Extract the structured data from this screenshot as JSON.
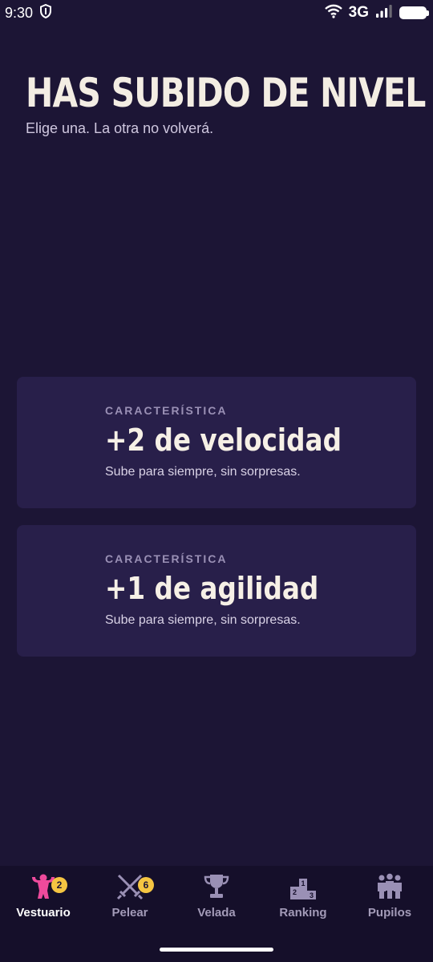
{
  "status_bar": {
    "time": "9:30",
    "network": "3G",
    "icons": [
      "shield-icon",
      "wifi-icon",
      "signal-icon",
      "battery-icon"
    ]
  },
  "header": {
    "title": "HAS SUBIDO DE NIVEL",
    "subtitle": "Elige una. La otra no volverá."
  },
  "options": [
    {
      "category": "CARACTERÍSTICA",
      "title": "+2 de velocidad",
      "description": "Sube para siempre, sin sorpresas."
    },
    {
      "category": "CARACTERÍSTICA",
      "title": "+1 de agilidad",
      "description": "Sube para siempre, sin sorpresas."
    }
  ],
  "nav": {
    "items": [
      {
        "label": "Vestuario",
        "icon": "strongman-icon",
        "badge": "2",
        "active": true
      },
      {
        "label": "Pelear",
        "icon": "crossed-swords-icon",
        "badge": "6",
        "active": false
      },
      {
        "label": "Velada",
        "icon": "trophy-icon",
        "badge": "",
        "active": false
      },
      {
        "label": "Ranking",
        "icon": "podium-icon",
        "badge": "",
        "active": false
      },
      {
        "label": "Pupilos",
        "icon": "group-icon",
        "badge": "",
        "active": false
      }
    ]
  },
  "colors": {
    "background": "#1c1535",
    "card": "#281f4a",
    "nav_background": "#150f2a",
    "accent_pink": "#ee4a9c",
    "badge_yellow": "#f5c542",
    "inactive_icon": "#9a90b5"
  }
}
